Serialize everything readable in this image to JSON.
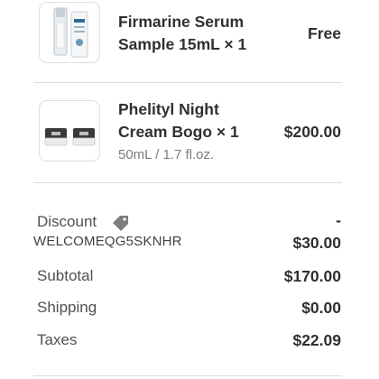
{
  "line_items": [
    {
      "name": "Firmarine Serum Sample 15mL × 1",
      "variant": "",
      "price": "Free",
      "thumbnail": "serum-bottle"
    },
    {
      "name": "Phelityl Night Cream Bogo × 1",
      "variant": "50mL / 1.7 fl.oz.",
      "price": "$200.00",
      "thumbnail": "cream-jars"
    }
  ],
  "summary": {
    "discount_label": "Discount",
    "discount_icon": "tag-icon",
    "discount_dash": "-",
    "discount_code": "WELCOMEQG5SKNHR",
    "discount_amount": "$30.00",
    "subtotal_label": "Subtotal",
    "subtotal_value": "$170.00",
    "shipping_label": "Shipping",
    "shipping_value": "$0.00",
    "taxes_label": "Taxes",
    "taxes_value": "$22.09"
  }
}
